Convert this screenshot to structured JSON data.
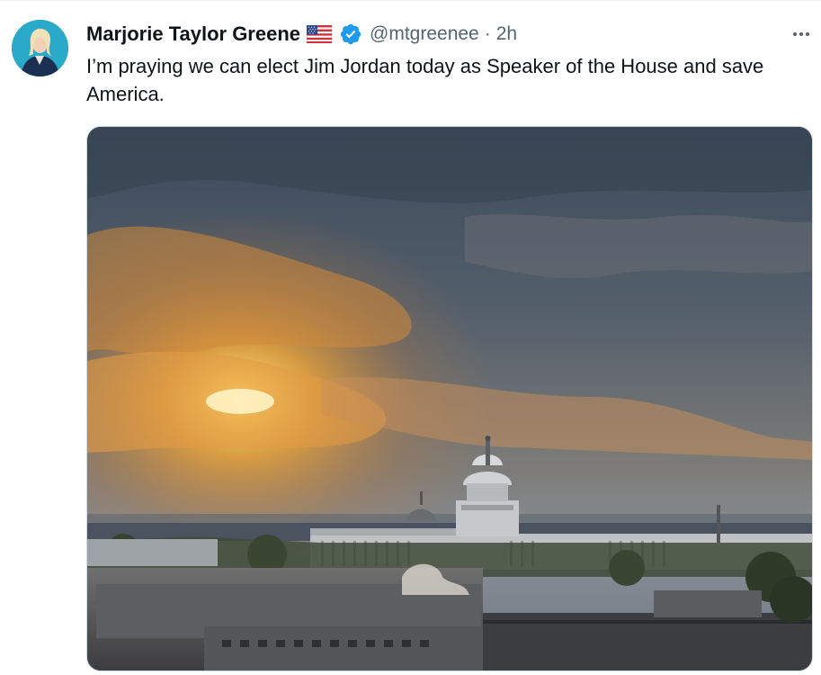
{
  "tweet": {
    "display_name": "Marjorie Taylor Greene",
    "handle": "@mtgreenee",
    "separator": "·",
    "time": "2h",
    "text": "I’m praying we can elect Jim Jordan today as Speaker of the House and save America.",
    "verified": true
  },
  "icons": {
    "avatar": "profile-photo",
    "flag": "us-flag-emoji",
    "verified": "verified-badge-icon",
    "more": "more-options-icon"
  },
  "media": {
    "description_icon": "photo-capitol-sunrise"
  },
  "colors": {
    "verified_blue": "#1d9bf0",
    "secondary_text": "#536471",
    "primary_text": "#0f1419"
  }
}
